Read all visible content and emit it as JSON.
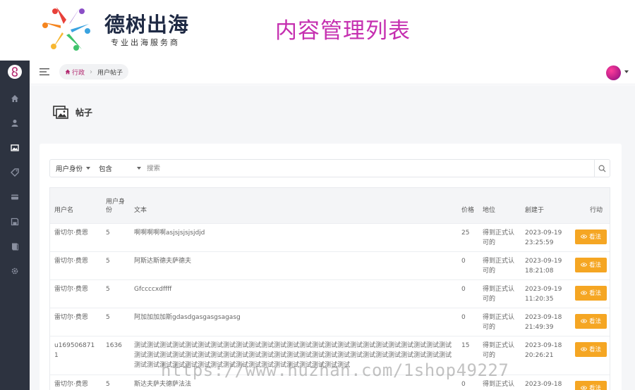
{
  "banner": {
    "brand_name": "德树出海",
    "brand_tagline": "专业出海服务商",
    "page_heading": "内容管理列表",
    "heading_color": "#c52fb0"
  },
  "sidebar": {
    "background": "#2d3340",
    "icons": [
      "home-icon",
      "user-icon",
      "image-icon",
      "tag-icon",
      "card-icon",
      "save-icon",
      "book-icon",
      "gear-icon"
    ]
  },
  "topbar": {
    "breadcrumb_home": "行政",
    "breadcrumb_current": "用户帖子"
  },
  "page": {
    "title": "帖子"
  },
  "filter": {
    "field": "用户身份",
    "operator": "包含",
    "placeholder": "搜索"
  },
  "table": {
    "headers": {
      "user": "用户名",
      "user_id": "用户身份",
      "text": "文本",
      "price": "价格",
      "status": "地位",
      "created": "創建于",
      "action": "行动"
    },
    "rows": [
      {
        "user": "雷切尔·费恩",
        "user_id": "5",
        "text": "啊啊啊啊啊asjsjsjsjsjdjd",
        "price": "25",
        "status": "得到正式认可的",
        "created": "2023-09-19 23:25:59",
        "action": "看法"
      },
      {
        "user": "雷切尔·费恩",
        "user_id": "5",
        "text": "阿斯达斯德夫萨德夫",
        "price": "0",
        "status": "得到正式认可的",
        "created": "2023-09-19 18:21:08",
        "action": "看法"
      },
      {
        "user": "雷切尔·费恩",
        "user_id": "5",
        "text": "Gfccccxdffff",
        "price": "0",
        "status": "得到正式认可的",
        "created": "2023-09-19 11:20:35",
        "action": "看法"
      },
      {
        "user": "雷切尔·费恩",
        "user_id": "5",
        "text": "阿加加加加斯gdasdgasgasgsagasg",
        "price": "0",
        "status": "得到正式认可的",
        "created": "2023-09-18 21:49:39",
        "action": "看法"
      },
      {
        "user": "u1695068711",
        "user_id": "1636",
        "text": "测试测试测试测试测试测试测试测试测试测试测试测试测试测试测试测试测试测试测试测试测试测试测试测试测试测试测试测试测试测试测试测试测试测试测试测试测试测试测试测试测试测试测试测试测试测试测试测试测试测试测试测试测试测试测试测试测试测试测试测试测试测试测试测试测试测试测试",
        "price": "15",
        "status": "得到正式认可的",
        "created": "2023-09-18 20:26:21",
        "action": "看法"
      },
      {
        "user": "雷切尔·费恩",
        "user_id": "5",
        "text": "斯达夫萨夫德萨法法",
        "price": "0",
        "status": "得到正式认可的",
        "created": "2023-09-18",
        "action": "看法"
      }
    ]
  },
  "colors": {
    "accent_button": "#f5a623",
    "breadcrumb_home": "#b2286f"
  },
  "watermark": "https://www.huzhan.com/1shop49227"
}
